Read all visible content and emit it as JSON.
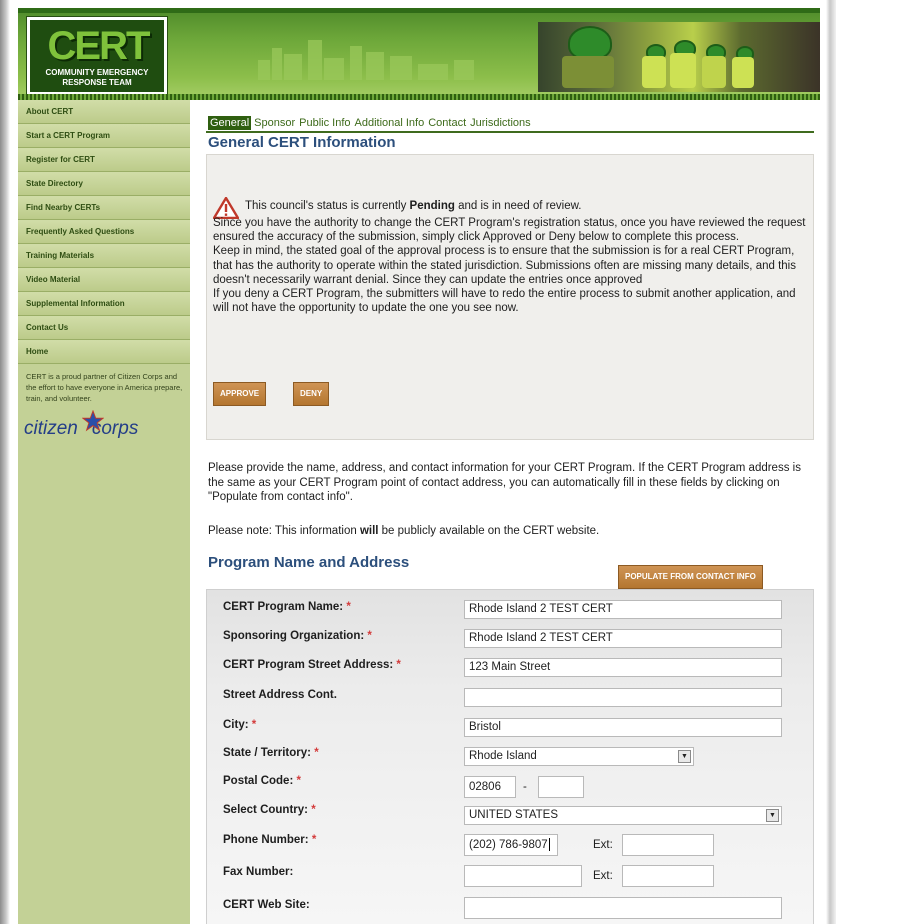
{
  "header": {
    "logo_title": "CERT",
    "logo_subtitle": "COMMUNITY EMERGENCY RESPONSE TEAM"
  },
  "sidebar": {
    "items": [
      {
        "label": "About CERT"
      },
      {
        "label": "Start a CERT Program"
      },
      {
        "label": "Register for CERT"
      },
      {
        "label": "State Directory"
      },
      {
        "label": "Find Nearby CERTs"
      },
      {
        "label": "Frequently Asked Questions"
      },
      {
        "label": "Training Materials"
      },
      {
        "label": "Video Material"
      },
      {
        "label": "Supplemental Information"
      },
      {
        "label": "Contact Us"
      },
      {
        "label": "Home"
      }
    ],
    "partner_note": "CERT is a proud partner of Citizen Corps and the effort to have everyone in America prepare, train, and volunteer.",
    "citizen_logo_a": "citizen",
    "citizen_logo_b": "corps"
  },
  "tabs": [
    {
      "label": "General",
      "active": true
    },
    {
      "label": "Sponsor"
    },
    {
      "label": "Public Info"
    },
    {
      "label": "Additional Info"
    },
    {
      "label": "Contact"
    },
    {
      "label": "Jurisdictions"
    }
  ],
  "general_heading": "General CERT Information",
  "alert": {
    "status_prefix": "This council's status is currently ",
    "status_value": "Pending",
    "status_suffix": " and is in need of review.",
    "paragraph_1": "Since you have the authority to change the CERT Program's registration status, once you have reviewed the request ensured the accuracy of the submission, simply click Approved or Deny below to complete this process.",
    "paragraph_2": "Keep in mind, the stated goal of the approval process is to ensure that the submission is for a real CERT Program, that has the authority to operate within the stated jurisdiction. Submissions often are missing many details, and this doesn't necessarily warrant denial. Since they can update the entries once approved",
    "paragraph_3": "If you deny a CERT Program, the submitters will have to redo the entire process to submit another application, and will not have the opportunity to update the one you see now.",
    "approve_label": "APPROVE",
    "deny_label": "DENY"
  },
  "intro_text": "Please provide the name, address, and contact information for your CERT Program. If the CERT Program address is the same as your CERT Program point of contact address, you can automatically fill in these fields by clicking on \"Populate from contact info\".",
  "note": {
    "prefix": "Please note: This information ",
    "bold": "will",
    "suffix": " be publicly available on the CERT website."
  },
  "section_heading": "Program Name and Address",
  "populate_label": "POPULATE FROM CONTACT INFO",
  "form": {
    "program_name": {
      "label": "CERT Program Name:",
      "required": "*",
      "value": "Rhode Island 2 TEST CERT"
    },
    "sponsoring_org": {
      "label": "Sponsoring Organization:",
      "required": "*",
      "value": "Rhode Island 2 TEST CERT"
    },
    "street": {
      "label": "CERT Program Street Address:",
      "required": "*",
      "value": "123 Main Street"
    },
    "street2": {
      "label": "Street Address Cont.",
      "value": ""
    },
    "city": {
      "label": "City:",
      "required": "*",
      "value": "Bristol"
    },
    "state": {
      "label": "State / Territory:",
      "required": "*",
      "value": "Rhode Island"
    },
    "postal": {
      "label": "Postal Code:",
      "required": "*",
      "value": "02806",
      "separator": "-",
      "ext_value": ""
    },
    "country": {
      "label": "Select Country:",
      "required": "*",
      "value": "UNITED STATES"
    },
    "phone": {
      "label": "Phone Number:",
      "required": "*",
      "value": "(202) 786-9807",
      "ext_label": "Ext:",
      "ext_value": ""
    },
    "fax": {
      "label": "Fax Number:",
      "value": "",
      "ext_label": "Ext:",
      "ext_value": ""
    },
    "website": {
      "label": "CERT Web Site:",
      "value": ""
    }
  }
}
